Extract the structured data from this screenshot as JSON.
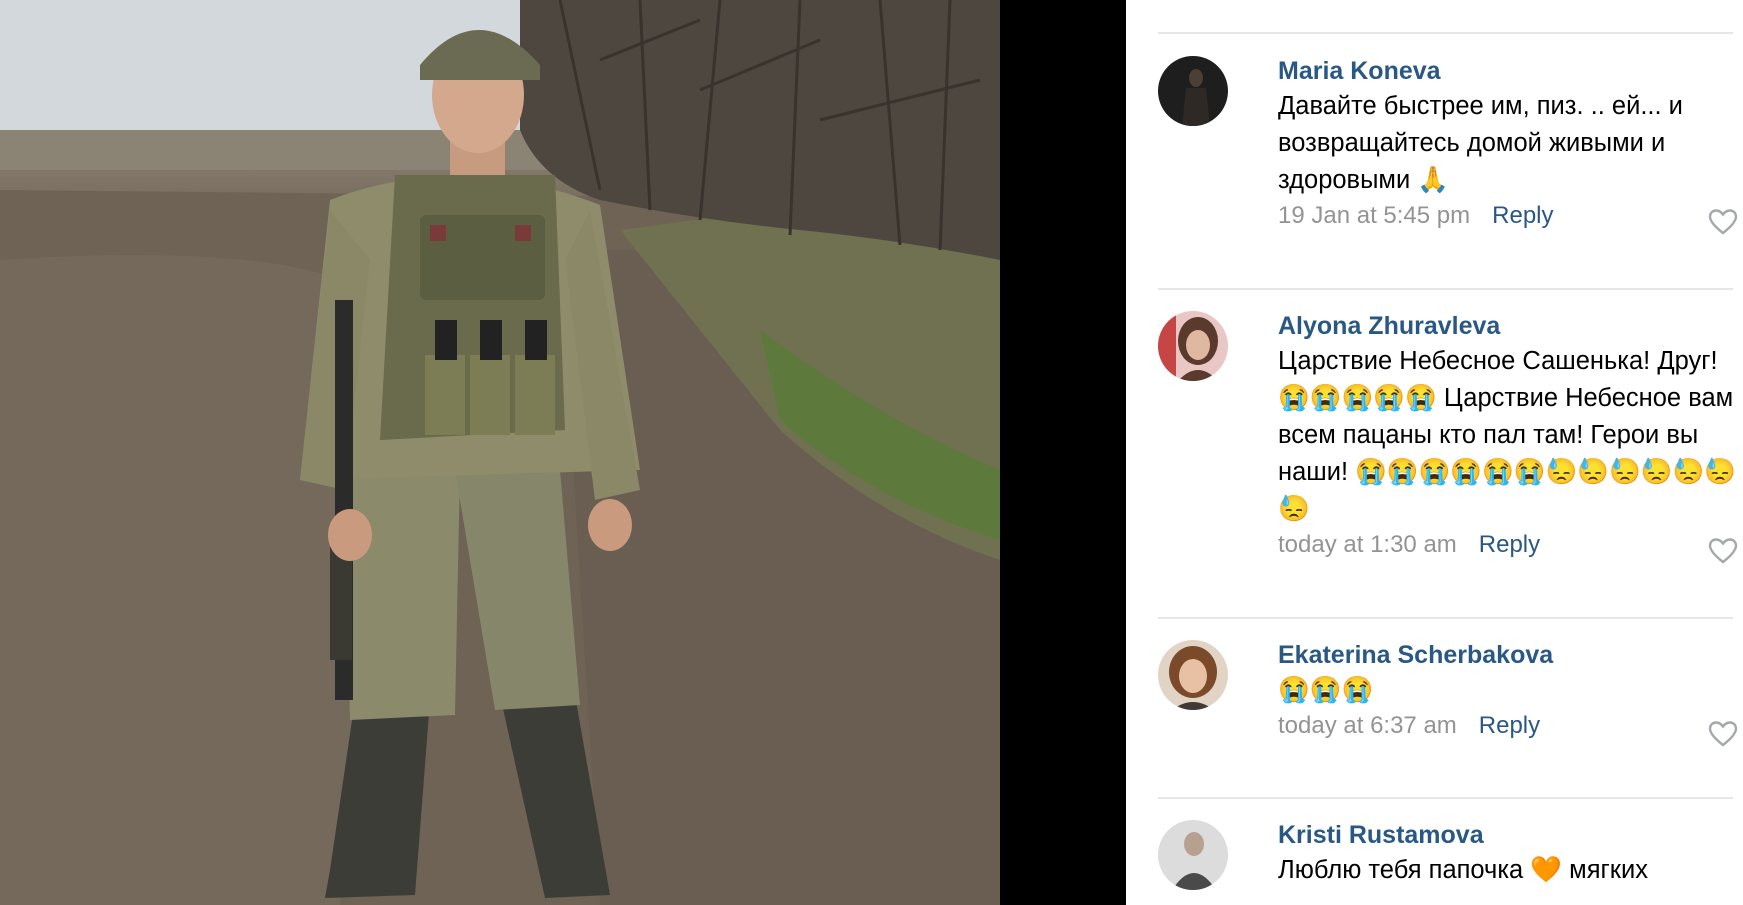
{
  "comments": [
    {
      "author": "Maria Koneva",
      "text": "Давайте быстрее им, пиз. .. ей... и возвращайтесь домой живыми и здоровыми 🙏",
      "time": "19 Jan at 5:45 pm",
      "reply": "Reply",
      "avatar": "dark-portrait"
    },
    {
      "author": "Alyona Zhuravleva",
      "text": "Царствие Небесное Сашенька! Друг! 😭😭😭😭😭 Царствие Небесное вам всем пацаны кто пал там! Герои вы наши! 😭😭😭😭😭😭😓😓😓😓😓😓😓",
      "time": "today at 1:30 am",
      "reply": "Reply",
      "avatar": "woman-portrait"
    },
    {
      "author": "Ekaterina Scherbakova",
      "text": "😭😭😭",
      "time": "today at 6:37 am",
      "reply": "Reply",
      "avatar": "woman-portrait"
    },
    {
      "author": "Kristi Rustamova",
      "text": "Люблю тебя папочка 🧡 мягких",
      "avatar": "woman-portrait"
    }
  ],
  "icons": {
    "like": "heart-outline-icon"
  },
  "colors": {
    "link": "#2a5885",
    "meta": "#939393",
    "divider": "#e4e6e8"
  }
}
